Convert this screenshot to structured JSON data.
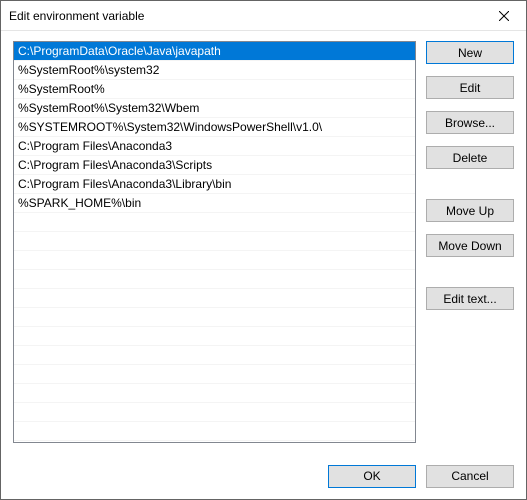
{
  "window": {
    "title": "Edit environment variable"
  },
  "list": {
    "items": [
      "C:\\ProgramData\\Oracle\\Java\\javapath",
      "%SystemRoot%\\system32",
      "%SystemRoot%",
      "%SystemRoot%\\System32\\Wbem",
      "%SYSTEMROOT%\\System32\\WindowsPowerShell\\v1.0\\",
      "C:\\Program Files\\Anaconda3",
      "C:\\Program Files\\Anaconda3\\Scripts",
      "C:\\Program Files\\Anaconda3\\Library\\bin",
      "%SPARK_HOME%\\bin"
    ],
    "selected_index": 0
  },
  "buttons": {
    "new": "New",
    "edit": "Edit",
    "browse": "Browse...",
    "delete": "Delete",
    "move_up": "Move Up",
    "move_down": "Move Down",
    "edit_text": "Edit text...",
    "ok": "OK",
    "cancel": "Cancel"
  }
}
